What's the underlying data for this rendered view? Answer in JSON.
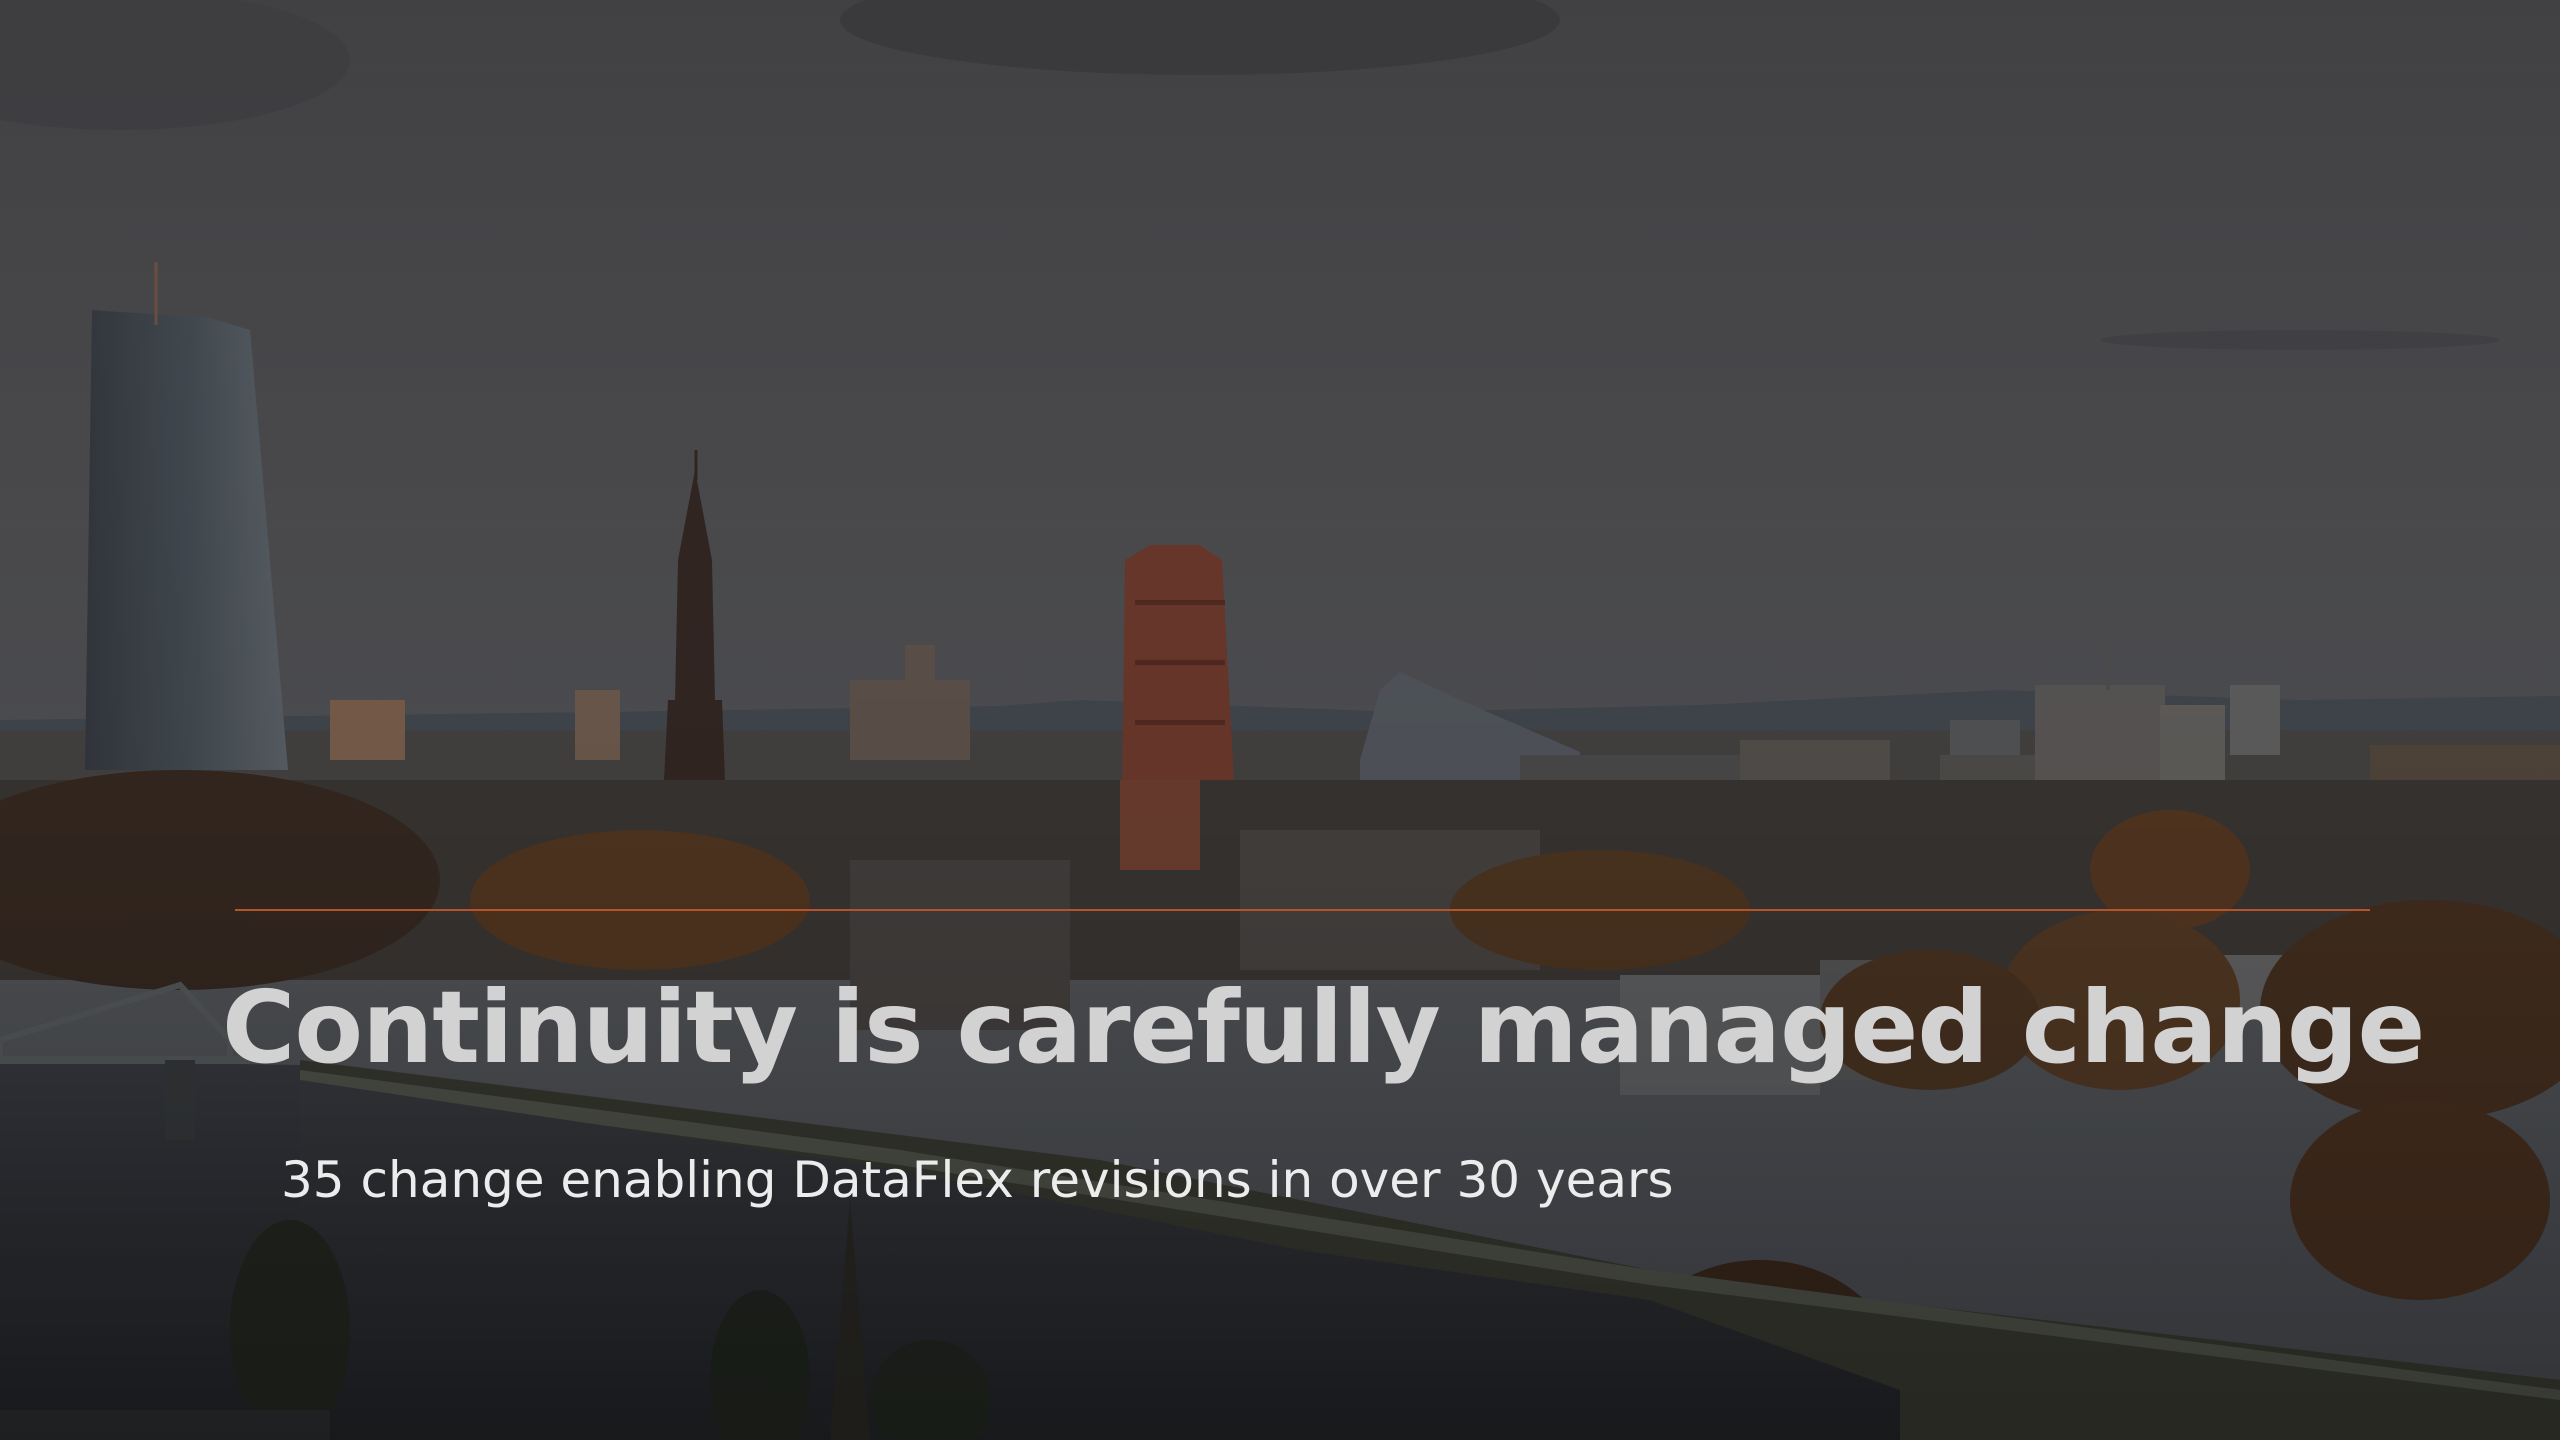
{
  "slide": {
    "title": "Continuity is carefully managed change",
    "subtitle": "35 change enabling DataFlex revisions in over 30 years"
  },
  "colors": {
    "accent_line": "#b5532a",
    "title": "#d2d2d2",
    "subtitle": "#ececec",
    "overlay": "#2f2f31"
  },
  "background": {
    "description_icon": "city-skyline-photo"
  }
}
